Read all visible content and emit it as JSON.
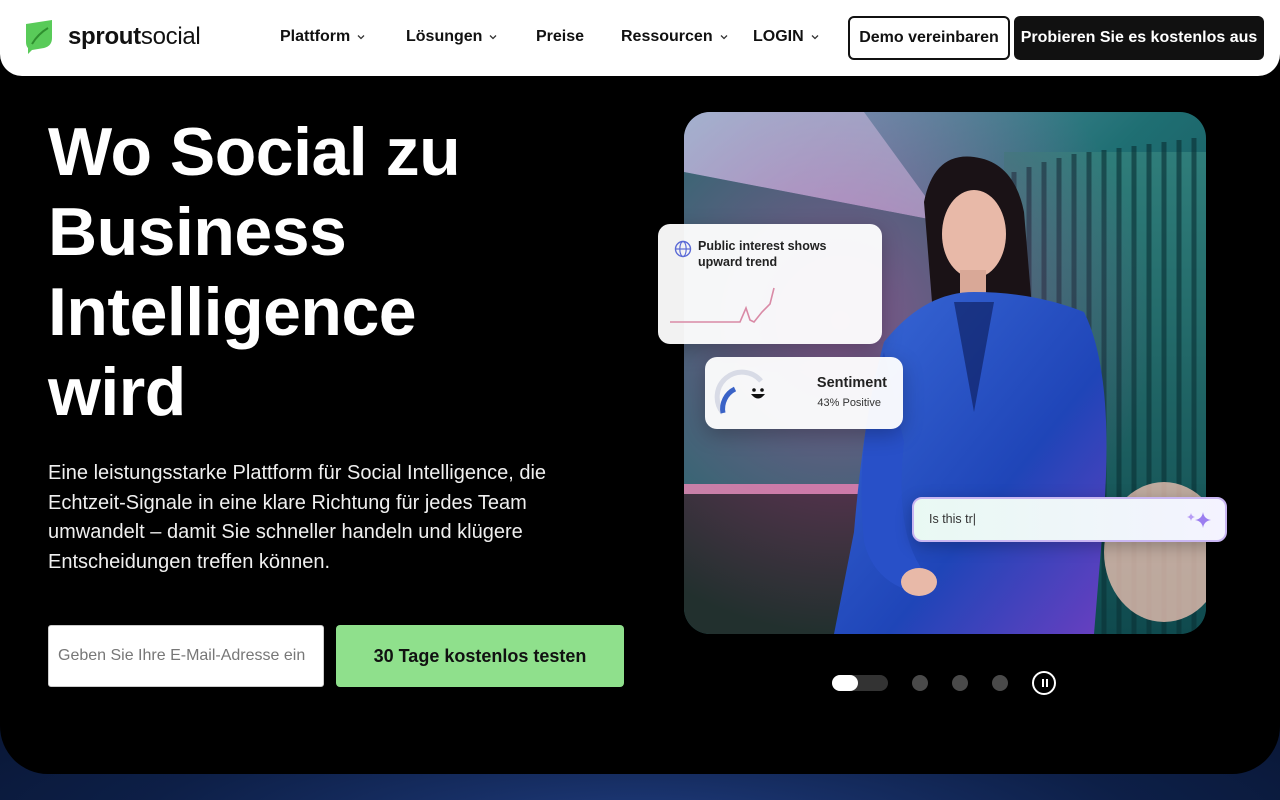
{
  "brand": {
    "name_bold": "sprout",
    "name_regular": "social",
    "logo_color": "#59cb59"
  },
  "nav": {
    "items": [
      {
        "label": "Plattform",
        "has_dropdown": true
      },
      {
        "label": "Lösungen",
        "has_dropdown": true
      },
      {
        "label": "Preise",
        "has_dropdown": false
      },
      {
        "label": "Ressourcen",
        "has_dropdown": true
      },
      {
        "label": "LOGIN",
        "has_dropdown": true
      }
    ],
    "demo_label": "Demo vereinbaren",
    "trial_label": "Probieren Sie es kostenlos aus"
  },
  "hero": {
    "headline_lines": [
      "Wo Social zu",
      "Business",
      "Intelligence",
      "wird"
    ],
    "subtext": "Eine leistungsstarke Plattform für Social Intelligence, die Echtzeit-Signale in eine klare Richtung für jedes Team umwandelt – damit Sie schneller handeln und klügere Entscheidungen treffen können.",
    "email_placeholder": "Geben Sie Ihre E-Mail-Adresse ein",
    "cta_label": "30 Tage kostenlos testen",
    "cta_color": "#8fe08c"
  },
  "cards": {
    "interest_title": "Public interest shows upward trend",
    "sentiment_title": "Sentiment",
    "sentiment_value": "43% Positive",
    "input_text": "Is this tr|"
  },
  "carousel": {
    "slide_count": 4,
    "active_index": 0
  },
  "icons": [
    "chevron-down-icon",
    "globe-icon",
    "smiley-icon",
    "sparkle-icon",
    "pause-icon"
  ]
}
